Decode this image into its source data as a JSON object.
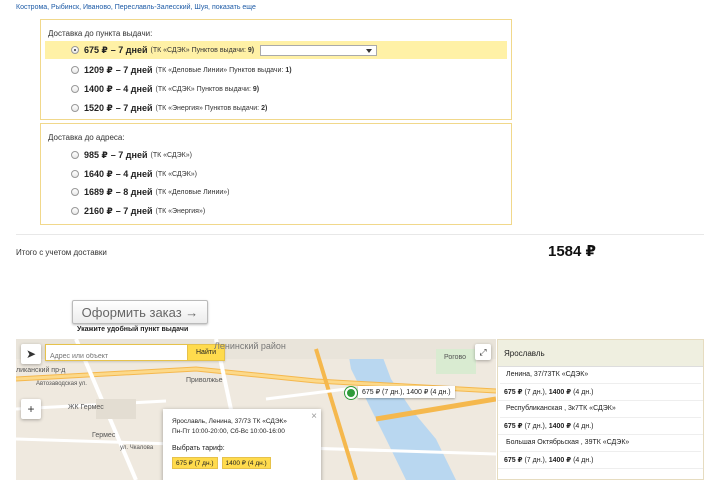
{
  "cities": {
    "list": "Кострома, Рыбинск, Иваново, Переславль-Залесский, Шуя,",
    "show_all": "показать еще"
  },
  "pickup": {
    "title": "Доставка до пункта выдачи:",
    "options": [
      {
        "price": "675 ₽",
        "days": "– 7 дней",
        "carrier": "(ТК «СДЭК» Пунктов выдачи:",
        "points": "9)",
        "selected": true
      },
      {
        "price": "1209 ₽",
        "days": "– 7 дней",
        "carrier": "(ТК «Деловые Линии» Пунктов выдачи:",
        "points": "1)",
        "selected": false
      },
      {
        "price": "1400 ₽",
        "days": "– 4 дней",
        "carrier": "(ТК «СДЭК» Пунктов выдачи:",
        "points": "9)",
        "selected": false
      },
      {
        "price": "1520 ₽",
        "days": "– 7 дней",
        "carrier": "(ТК «Энергия» Пунктов выдачи:",
        "points": "2)",
        "selected": false
      }
    ]
  },
  "address": {
    "title": "Доставка до адреса:",
    "options": [
      {
        "price": "985 ₽",
        "days": "– 7 дней",
        "carrier": "(ТК «СДЭК»)"
      },
      {
        "price": "1640 ₽",
        "days": "– 4 дней",
        "carrier": "(ТК «СДЭК»)"
      },
      {
        "price": "1689 ₽",
        "days": "– 8 дней",
        "carrier": "(ТК «Деловые Линии»)"
      },
      {
        "price": "2160 ₽",
        "days": "– 7 дней",
        "carrier": "(ТК «Энергия»)"
      }
    ]
  },
  "total": {
    "label": "Итого с учетом доставки",
    "value": "1584 ₽"
  },
  "order": {
    "button": "Оформить заказ →",
    "hint": "Укажите удобный пункт выдачи"
  },
  "map": {
    "search_placeholder": "Адрес или объект",
    "search_button": "Найти",
    "zoom_in": "+",
    "labels": {
      "district": "Ленинский район",
      "street1": "ликанский пр-д",
      "street2": "Автозаводская ул.",
      "station": "Приволжье",
      "shop1": "ЖК Гермес",
      "shop2": "Гермес",
      "street3": "ул. Чкалова",
      "place": "Рогово"
    },
    "pin_tooltip": "675 ₽ (7 дн.), 1400 ₽ (4 дн.)",
    "popup": {
      "address_bold": "Ярославль, Ленина, 37/73",
      "address_rest": "ТК «СДЭК»",
      "hours": "Пн-Пт 10:00-20:00, Сб-Вс 10:00-16:00",
      "tariff_label": "Выбрать тариф:",
      "tariff1": "675 ₽ (7 дн.)",
      "tariff2": "1400 ₽ (4 дн.)"
    }
  },
  "panel": {
    "city": "Ярославль",
    "rows": [
      {
        "type": "addr",
        "text": "Ленина, 37/73ТК «СДЭК»"
      },
      {
        "type": "price",
        "p1": "675 ₽",
        "d1": "(7 дн.),",
        "p2": "1400 ₽",
        "d2": "(4 дн.)"
      },
      {
        "type": "addr",
        "text": "Республиканская , 3к7ТК «СДЭК»"
      },
      {
        "type": "price",
        "p1": "675 ₽",
        "d1": "(7 дн.),",
        "p2": "1400 ₽",
        "d2": "(4 дн.)"
      },
      {
        "type": "addr",
        "text": "Большая Октябрьская , 39ТК «СДЭК»"
      },
      {
        "type": "price",
        "p1": "675 ₽",
        "d1": "(7 дн.),",
        "p2": "1400 ₽",
        "d2": "(4 дн.)"
      }
    ]
  },
  "colors": {
    "accent_yellow": "#ffdb4d",
    "selected_bg": "#fff1a6",
    "border": "#f1d88b",
    "link": "#1c5aa6",
    "pin": "#2f9b3a",
    "water": "#b9d7f0"
  }
}
